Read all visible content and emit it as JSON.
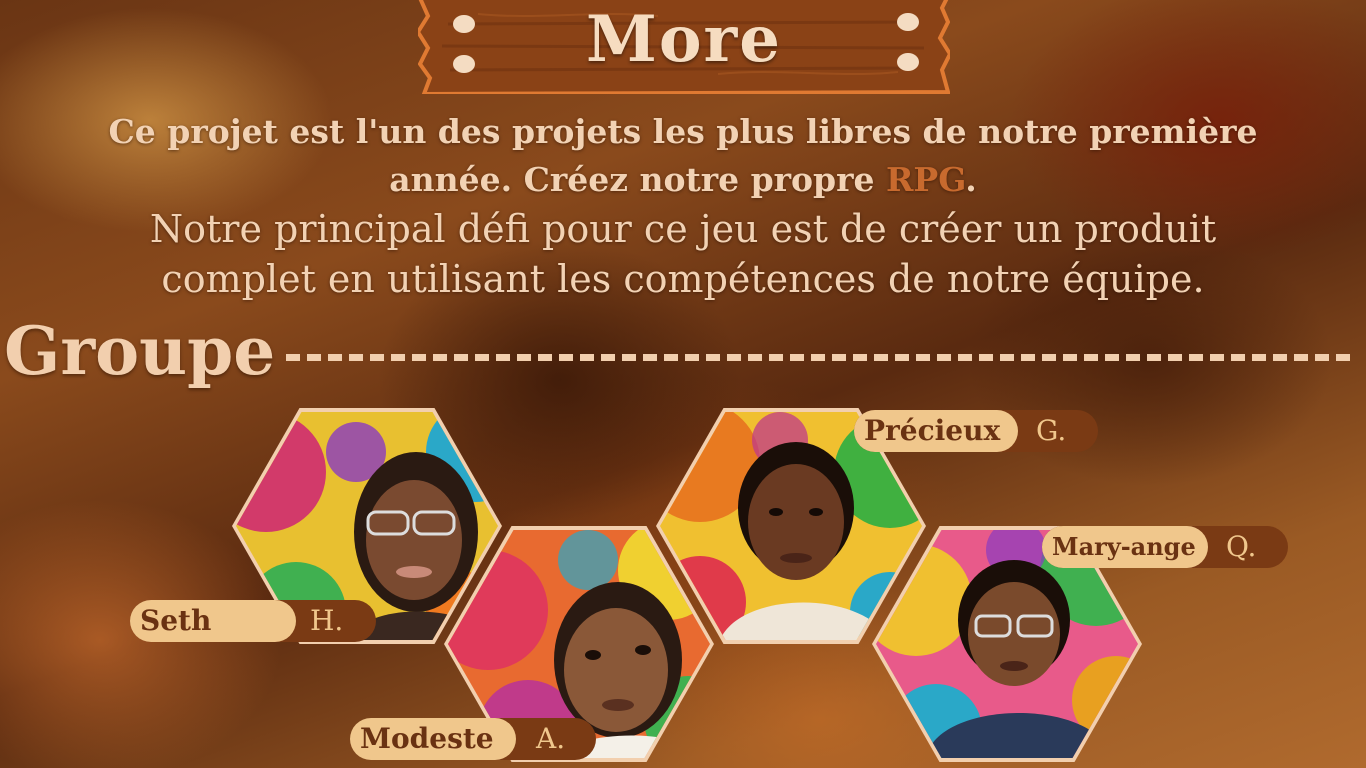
{
  "sign": {
    "title": "More"
  },
  "description": {
    "lead_part1": "Ce projet est l'un des projets les plus libres de notre première année. Créez notre propre ",
    "lead_highlight": "RPG",
    "lead_part2": ".",
    "body": "Notre principal défi pour ce jeu est de créer un produit complet en utilisant les compétences de notre équipe."
  },
  "group": {
    "label": "Groupe",
    "members": [
      {
        "first": "Seth",
        "last": "H."
      },
      {
        "first": "Modeste",
        "last": "A."
      },
      {
        "first": "Précieux",
        "last": "G."
      },
      {
        "first": "Mary-ange",
        "last": "Q."
      }
    ]
  },
  "colors": {
    "text_light": "#f2d2b4",
    "highlight": "#c86a2e",
    "tag_light": "#f0c78c",
    "tag_dark": "#7a3a14",
    "wood": "#8a4216"
  }
}
